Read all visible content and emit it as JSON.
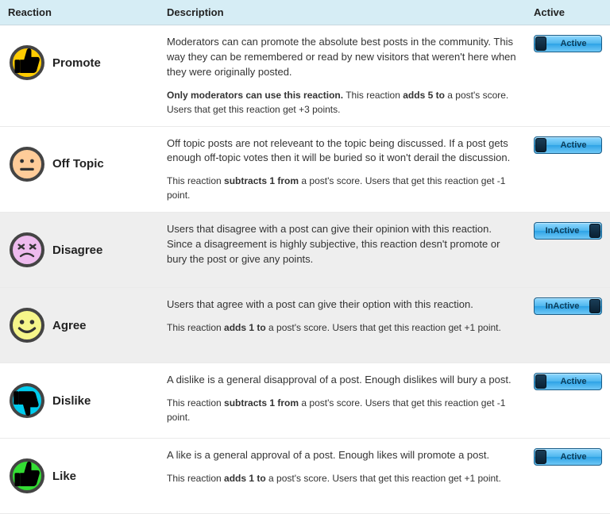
{
  "headers": {
    "reaction": "Reaction",
    "description": "Description",
    "active": "Active"
  },
  "toggle_labels": {
    "active": "Active",
    "inactive": "InActive"
  },
  "reactions": [
    {
      "key": "promote",
      "name": "Promote",
      "icon": "promote-icon",
      "active": true,
      "desc": "Moderators can can promote the absolute best posts in the community. This way they can be remembered or read by new visitors that weren't here when they were originally posted.",
      "meta_prefix_bold": "Only moderators can use this reaction.",
      "meta_mid1": " This reaction ",
      "meta_bold2": "adds 5 to",
      "meta_tail": " a post's score. Users that get this reaction get +3 points."
    },
    {
      "key": "offtopic",
      "name": "Off Topic",
      "icon": "offtopic-icon",
      "active": true,
      "desc": "Off topic posts are not releveant to the topic being discussed. If a post gets enough off-topic votes then it will be buried so it won't derail the discussion.",
      "meta_prefix_bold": "",
      "meta_mid1": "This reaction ",
      "meta_bold2": "subtracts 1 from",
      "meta_tail": " a post's score. Users that get this reaction get -1 point."
    },
    {
      "key": "disagree",
      "name": "Disagree",
      "icon": "disagree-icon",
      "active": false,
      "desc": "Users that disagree with a post can give their opinion with this reaction. Since a disagreement is highly subjective, this reaction desn't promote or bury the post or give any points.",
      "meta_prefix_bold": "",
      "meta_mid1": "",
      "meta_bold2": "",
      "meta_tail": ""
    },
    {
      "key": "agree",
      "name": "Agree",
      "icon": "agree-icon",
      "active": false,
      "desc": "Users that agree with a post can give their option with this reaction.",
      "meta_prefix_bold": "",
      "meta_mid1": "This reaction ",
      "meta_bold2": "adds 1 to",
      "meta_tail": " a post's score. Users that get this reaction get +1 point."
    },
    {
      "key": "dislike",
      "name": "Dislike",
      "icon": "dislike-icon",
      "active": true,
      "desc": "A dislike is a general disapproval of a post. Enough dislikes will bury a post.",
      "meta_prefix_bold": "",
      "meta_mid1": "This reaction ",
      "meta_bold2": "subtracts 1 from",
      "meta_tail": " a post's score. Users that get this reaction get -1 point."
    },
    {
      "key": "like",
      "name": "Like",
      "icon": "like-icon",
      "active": true,
      "desc": "A like is a general approval of a post. Enough likes will promote a post.",
      "meta_prefix_bold": "",
      "meta_mid1": "This reaction ",
      "meta_bold2": "adds 1 to",
      "meta_tail": " a post's score. Users that get this reaction get +1 point."
    }
  ]
}
